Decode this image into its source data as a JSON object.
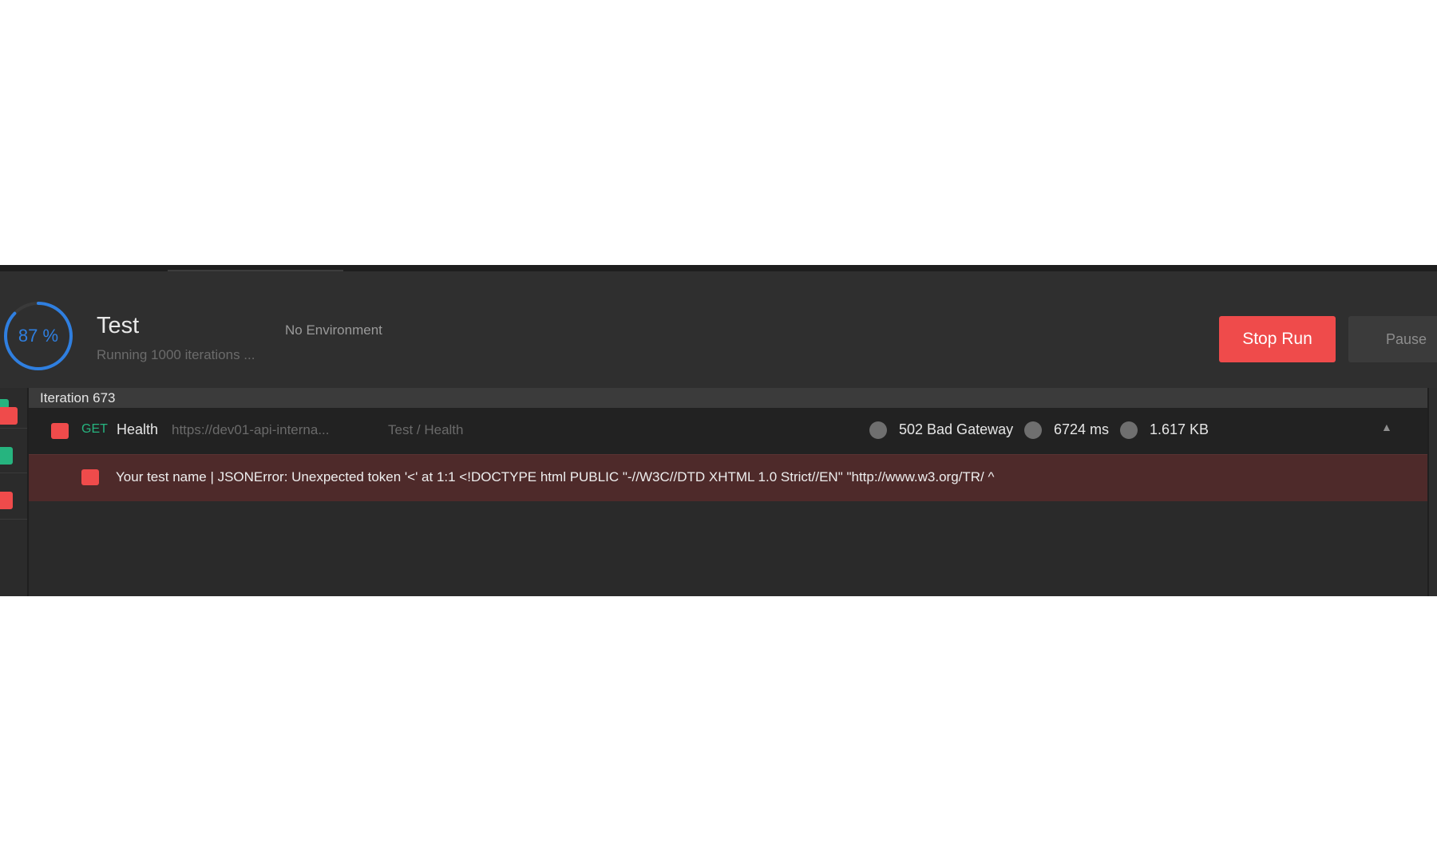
{
  "run": {
    "progress_label": "87 %",
    "progress_percent": 87,
    "title": "Test",
    "subtitle": "Running 1000 iterations ...",
    "environment": "No Environment"
  },
  "actions": {
    "stop_label": "Stop Run",
    "pause_label": "Pause"
  },
  "iteration": {
    "label": "Iteration 673"
  },
  "request": {
    "method": "GET",
    "name": "Health",
    "url": "https://dev01-api-interna...",
    "path": "Test / Health",
    "status": "502 Bad Gateway",
    "time": "6724 ms",
    "size": "1.617 KB"
  },
  "test_result": {
    "message": "Your test name | JSONError: Unexpected token '<' at 1:1 <!DOCTYPE html PUBLIC \"-//W3C//DTD XHTML 1.0 Strict//EN\" \"http://www.w3.org/TR/ ^"
  },
  "colors": {
    "accent_blue": "#2f7fe0",
    "fail_red": "#ef4b4b",
    "pass_green": "#26b47f",
    "error_row_bg": "#4e2a2a",
    "app_bg": "#2b2b2b"
  }
}
